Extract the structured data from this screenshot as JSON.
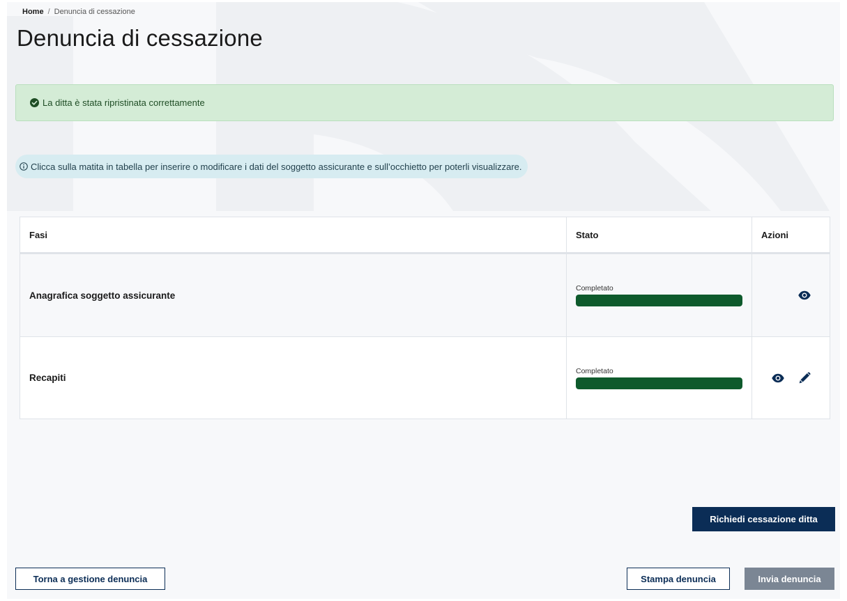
{
  "breadcrumb": {
    "home": "Home",
    "separator": "/",
    "current": "Denuncia di cessazione"
  },
  "page": {
    "title": "Denuncia di cessazione"
  },
  "alert": {
    "message": "La ditta è stata ripristinata correttamente",
    "icon": "check-circle-icon"
  },
  "info": {
    "message": "Clicca sulla matita in tabella per inserire o modificare i dati del soggetto assicurante e sull’occhietto per poterli visualizzare.",
    "icon": "info-circle-icon"
  },
  "table": {
    "headers": {
      "phases": "Fasi",
      "status": "Stato",
      "actions": "Azioni"
    },
    "rows": [
      {
        "phase": "Anagrafica soggetto assicurante",
        "status": "Completato",
        "progress": 1.0,
        "actions": [
          "eye-icon"
        ]
      },
      {
        "phase": "Recapiti",
        "status": "Completato",
        "progress": 1.0,
        "actions": [
          "eye-icon",
          "pencil-icon"
        ]
      }
    ]
  },
  "buttons": {
    "request": "Richiedi cessazione ditta",
    "back": "Torna a gestione denuncia",
    "print": "Stampa denuncia",
    "send": "Invia denuncia"
  },
  "colors": {
    "primary": "#0b2d56",
    "progress_fill": "#0e5a2c",
    "alert_bg": "#d4ecd6",
    "info_bg": "#d7ecf1",
    "disabled": "#7b8694"
  }
}
